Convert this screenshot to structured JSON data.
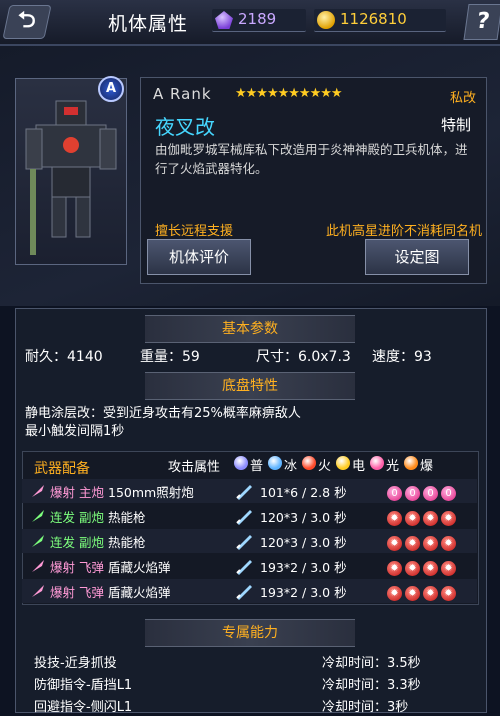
{
  "header": {
    "back_icon": "back-arrow-icon",
    "title": "机体属性",
    "gems": "2189",
    "gold": "1126810",
    "help_label": "?"
  },
  "mech": {
    "rank_badge": "A",
    "rank_text": "A  Rank",
    "stars": "★★★★★★★★★★",
    "private_tag": "私改",
    "name": "夜叉改",
    "special_tag": "特制",
    "description": "由伽毗罗城军械库私下改造用于炎神神殿的卫兵机体，进行了火焰武器特化。",
    "trait_left": "擅长远程支援",
    "trait_right": "此机高星进阶不消耗同名机",
    "eval_button": "机体评价",
    "setting_button": "设定图"
  },
  "basic": {
    "title": "基本参数",
    "durability": "耐久：4140",
    "weight": "重量：59",
    "size": "尺寸：6.0x7.3",
    "speed": "速度：93"
  },
  "chassis": {
    "title": "底盘特性",
    "line1": "静电涂层改：受到近身攻击有25%概率麻痹敌人",
    "line2": "最小触发间隔1秒"
  },
  "weapons": {
    "header": "武器配备",
    "attr_label": "攻击属性",
    "elements": [
      "普",
      "冰",
      "火",
      "电",
      "光",
      "爆"
    ],
    "element_colors": [
      "#8c8cff",
      "#5fb4ff",
      "#ff4a2a",
      "#ffcc22",
      "#ff5fa8",
      "#ff8a1a"
    ],
    "rows": [
      {
        "type": "爆射 主炮",
        "type_color": "#ff9ad6",
        "name": "150mm照射炮",
        "damage": "101*6 / 2.8 秒",
        "dot_style": "pink",
        "dots": [
          "0",
          "0",
          "0",
          "0"
        ]
      },
      {
        "type": "连发 副炮",
        "type_color": "#7dff7d",
        "name": "热能枪",
        "damage": "120*3 / 3.0 秒",
        "dot_style": "red",
        "dots": [
          "✹",
          "✹",
          "✹",
          "✹"
        ]
      },
      {
        "type": "连发 副炮",
        "type_color": "#7dff7d",
        "name": "热能枪",
        "damage": "120*3 / 3.0 秒",
        "dot_style": "red",
        "dots": [
          "✹",
          "✹",
          "✹",
          "✹"
        ]
      },
      {
        "type": "爆射 飞弹",
        "type_color": "#ff9ad6",
        "name": "盾藏火焰弹",
        "damage": "193*2 / 3.0 秒",
        "dot_style": "red",
        "dots": [
          "✹",
          "✹",
          "✹",
          "✹"
        ]
      },
      {
        "type": "爆射 飞弹",
        "type_color": "#ff9ad6",
        "name": "盾藏火焰弹",
        "damage": "193*2 / 3.0 秒",
        "dot_style": "red",
        "dots": [
          "✹",
          "✹",
          "✹",
          "✹"
        ]
      }
    ]
  },
  "special": {
    "title": "专属能力",
    "rows": [
      {
        "skill": "投技-近身抓投",
        "cooldown": "冷却时间：3.5秒"
      },
      {
        "skill": "防御指令-盾挡L1",
        "cooldown": "冷却时间：3.3秒"
      },
      {
        "skill": "回避指令-侧闪L1",
        "cooldown": "冷却时间：3秒"
      }
    ]
  }
}
